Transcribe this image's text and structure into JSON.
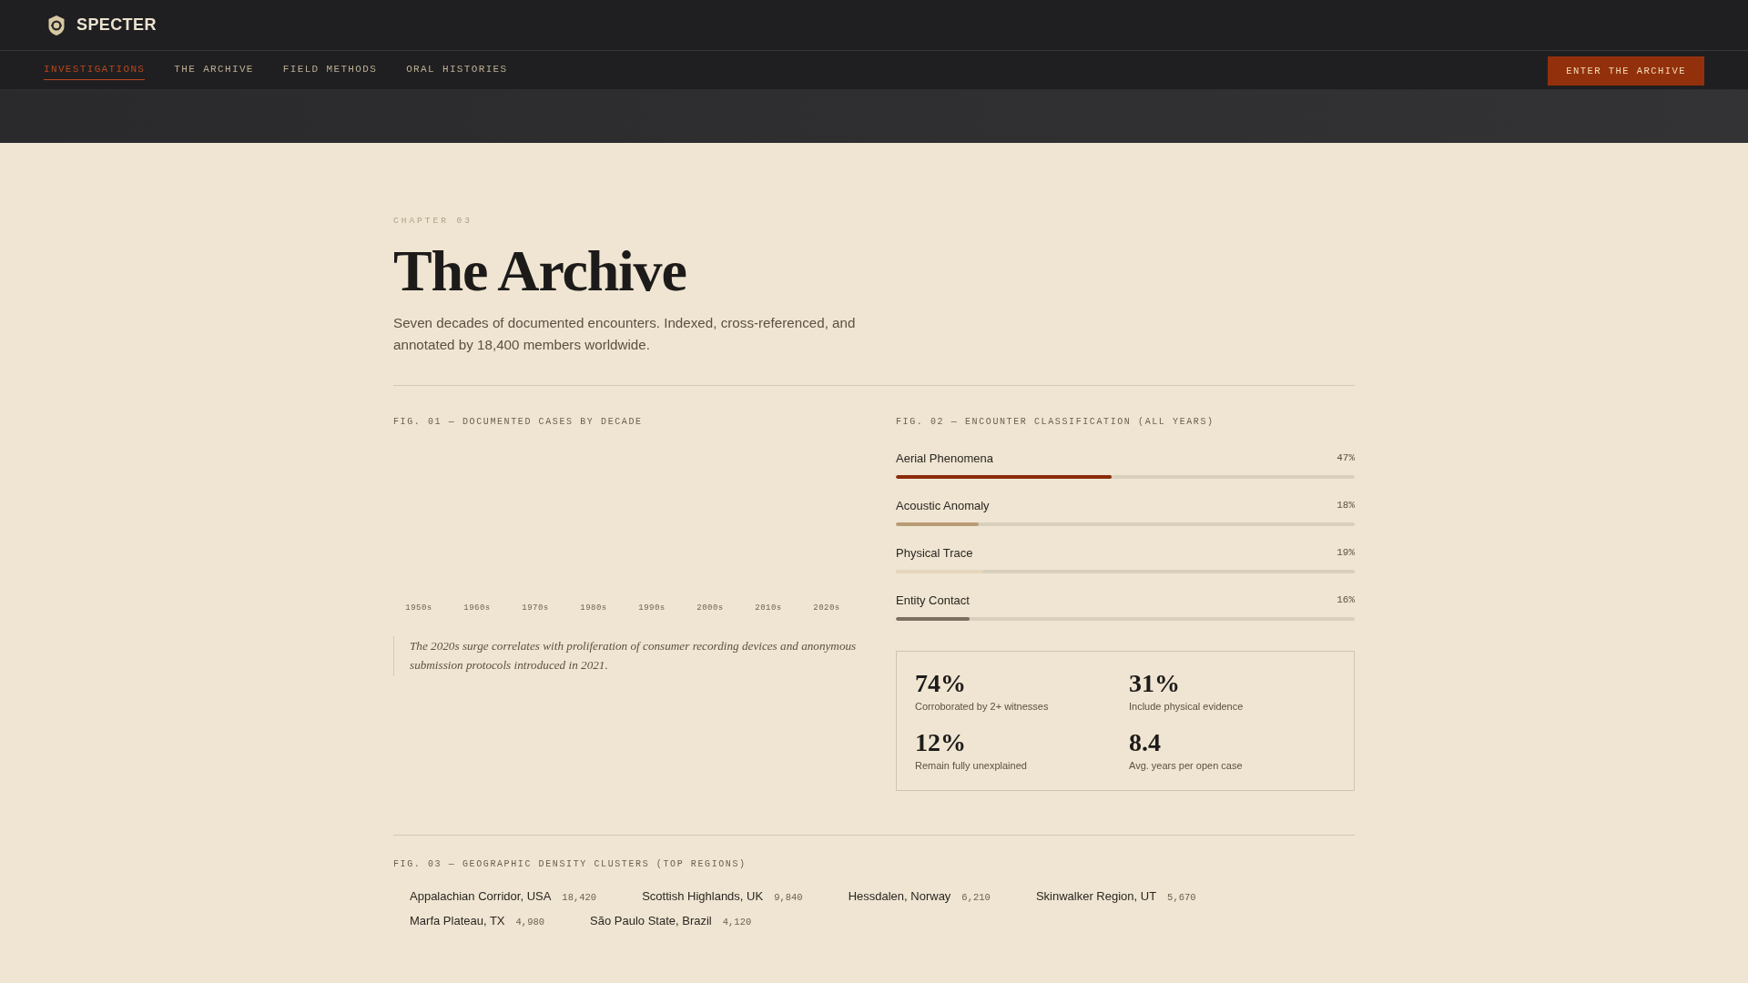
{
  "header": {
    "brand": "SPECTER"
  },
  "nav": {
    "tabs": [
      {
        "label": "INVESTIGATIONS",
        "selected": true
      },
      {
        "label": "THE ARCHIVE",
        "selected": false
      },
      {
        "label": "FIELD METHODS",
        "selected": false
      },
      {
        "label": "ORAL HISTORIES",
        "selected": false
      }
    ],
    "cta": "ENTER THE ARCHIVE"
  },
  "hero": {
    "eyebrow": "CHAPTER 03",
    "title": "The Archive",
    "subtitle": "Seven decades of documented encounters. Indexed, cross-referenced, and annotated by 18,400 members worldwide."
  },
  "fig1": {
    "caption": "FIG. 01 — DOCUMENTED CASES BY DECADE",
    "decades": [
      "1950s",
      "1960s",
      "1970s",
      "1980s",
      "1990s",
      "2000s",
      "2010s",
      "2020s"
    ],
    "note": "The 2020s surge correlates with proliferation of consumer recording devices and anonymous submission protocols introduced in 2021."
  },
  "fig2": {
    "caption": "FIG. 02 — ENCOUNTER CLASSIFICATION (ALL YEARS)",
    "classes": [
      {
        "name": "Aerial Phenomena",
        "reading": "47%",
        "level": 0.47,
        "color": "#8b2a0a"
      },
      {
        "name": "Acoustic Anomaly",
        "reading": "18%",
        "level": 0.18,
        "color": "#b89a74"
      },
      {
        "name": "Physical Trace",
        "reading": "19%",
        "level": 0.19,
        "color": "#e6d6bc"
      },
      {
        "name": "Entity Contact",
        "reading": "16%",
        "level": 0.16,
        "color": "#7a7062"
      }
    ],
    "stats": [
      {
        "value": "74%",
        "label": "Corroborated by 2+ witnesses"
      },
      {
        "value": "31%",
        "label": "Include physical evidence"
      },
      {
        "value": "12%",
        "label": "Remain fully unexplained"
      },
      {
        "value": "8.4",
        "label": "Avg. years per open case"
      }
    ]
  },
  "fig3": {
    "caption": "FIG. 03 — GEOGRAPHIC DENSITY CLUSTERS (TOP REGIONS)",
    "regions": [
      {
        "name": "Appalachian Corridor, USA",
        "count": "18,420"
      },
      {
        "name": "Scottish Highlands, UK",
        "count": "9,840"
      },
      {
        "name": "Hessdalen, Norway",
        "count": "6,210"
      },
      {
        "name": "Skinwalker Region, UT",
        "count": "5,670"
      },
      {
        "name": "Marfa Plateau, TX",
        "count": "4,980"
      },
      {
        "name": "São Paulo State, Brazil",
        "count": "4,120"
      }
    ]
  }
}
